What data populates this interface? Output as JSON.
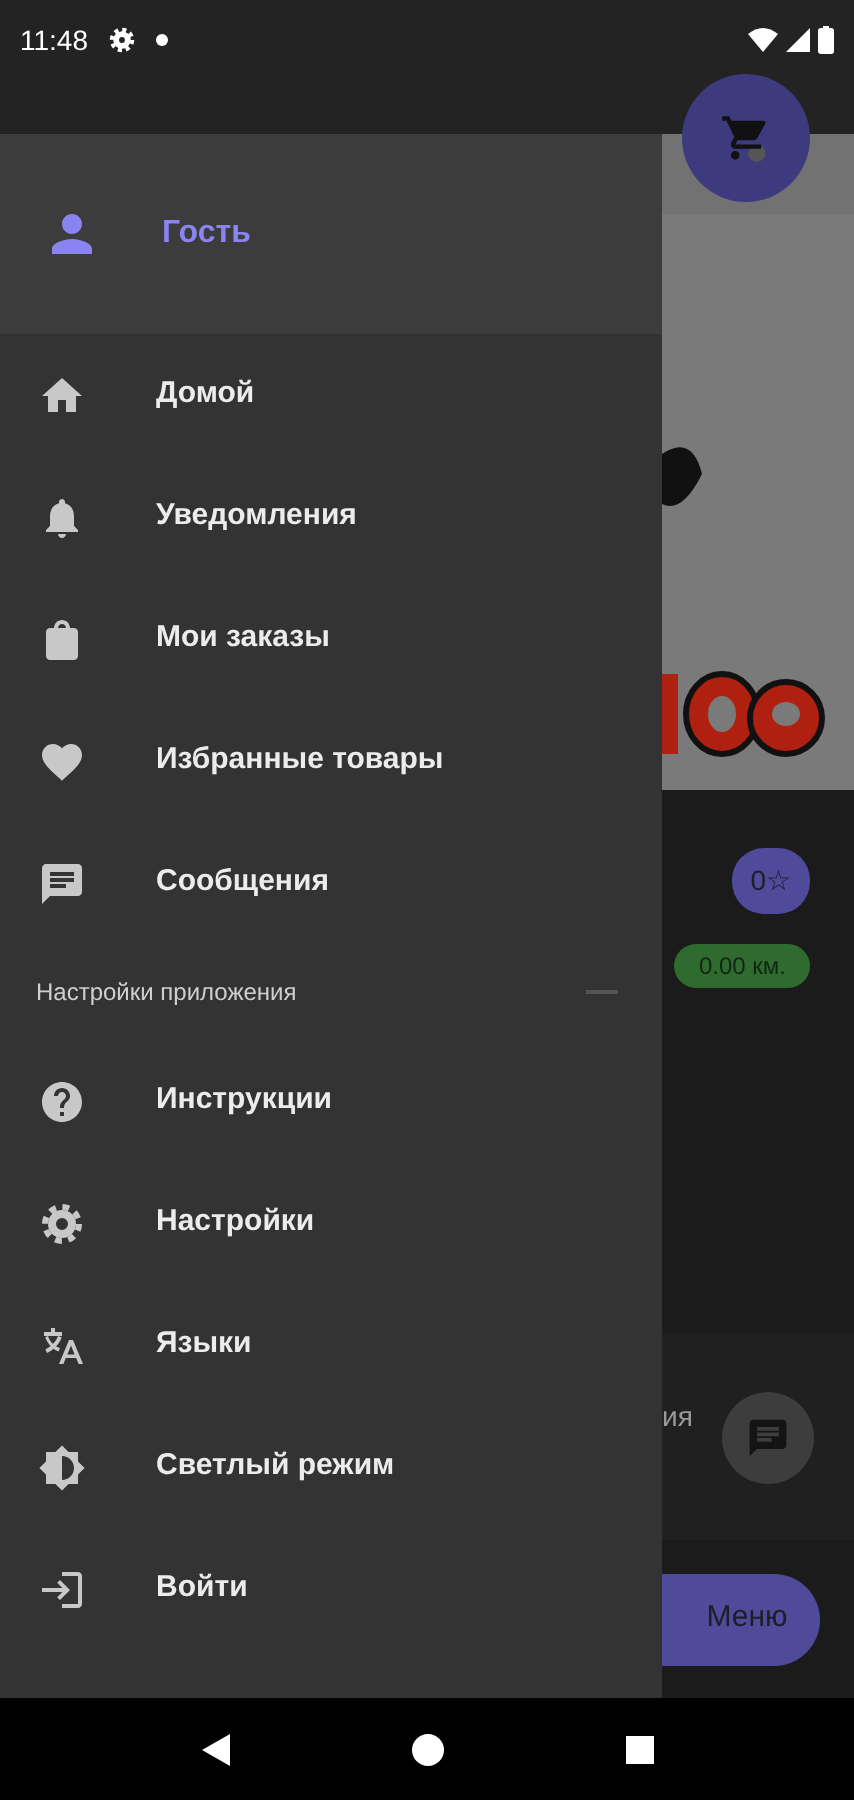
{
  "status_bar": {
    "time": "11:48"
  },
  "drawer": {
    "user": {
      "name": "Гость"
    },
    "items": [
      {
        "kind": "home",
        "label": "Домой"
      },
      {
        "kind": "bell",
        "label": "Уведомления"
      },
      {
        "kind": "bag",
        "label": "Мои заказы"
      },
      {
        "kind": "heart",
        "label": "Избранные товары"
      },
      {
        "kind": "chat",
        "label": "Сообщения"
      }
    ],
    "section": {
      "title": "Настройки приложения",
      "expanded": true
    },
    "settings_items": [
      {
        "kind": "help",
        "label": "Инструкции"
      },
      {
        "kind": "gear",
        "label": "Настройки"
      },
      {
        "kind": "translate",
        "label": "Языки"
      },
      {
        "kind": "brightness",
        "label": "Светлый режим"
      },
      {
        "kind": "login",
        "label": "Войти"
      }
    ]
  },
  "background": {
    "rating": "0☆",
    "distance": "0.00 км.",
    "partial_text": "ия",
    "menu_button": "Меню"
  }
}
